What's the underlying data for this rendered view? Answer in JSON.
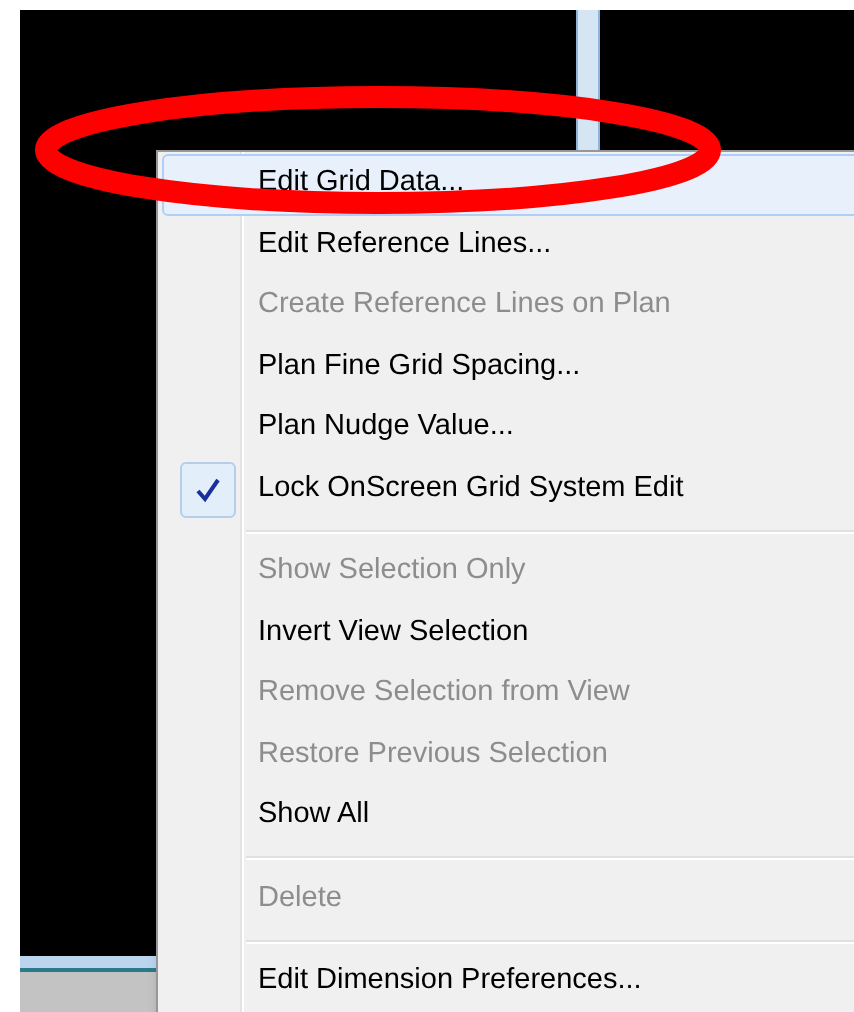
{
  "context_menu": {
    "items": [
      {
        "kind": "item",
        "label": "Edit Grid Data...",
        "selected": true,
        "disabled": false,
        "checked": false
      },
      {
        "kind": "item",
        "label": "Edit Reference Lines...",
        "selected": false,
        "disabled": false,
        "checked": false
      },
      {
        "kind": "item",
        "label": "Create Reference Lines on Plan",
        "selected": false,
        "disabled": true,
        "checked": false
      },
      {
        "kind": "item",
        "label": "Plan Fine Grid Spacing...",
        "selected": false,
        "disabled": false,
        "checked": false
      },
      {
        "kind": "item",
        "label": "Plan Nudge Value...",
        "selected": false,
        "disabled": false,
        "checked": false
      },
      {
        "kind": "item",
        "label": "Lock OnScreen Grid System Edit",
        "selected": false,
        "disabled": false,
        "checked": true
      },
      {
        "kind": "separator"
      },
      {
        "kind": "item",
        "label": "Show Selection Only",
        "selected": false,
        "disabled": true,
        "checked": false
      },
      {
        "kind": "item",
        "label": "Invert View Selection",
        "selected": false,
        "disabled": false,
        "checked": false
      },
      {
        "kind": "item",
        "label": "Remove Selection from View",
        "selected": false,
        "disabled": true,
        "checked": false
      },
      {
        "kind": "item",
        "label": "Restore Previous Selection",
        "selected": false,
        "disabled": true,
        "checked": false
      },
      {
        "kind": "item",
        "label": "Show All",
        "selected": false,
        "disabled": false,
        "checked": false
      },
      {
        "kind": "separator"
      },
      {
        "kind": "item",
        "label": "Delete",
        "selected": false,
        "disabled": true,
        "checked": false
      },
      {
        "kind": "separator"
      },
      {
        "kind": "item",
        "label": "Edit Dimension Preferences...",
        "selected": false,
        "disabled": false,
        "checked": false
      }
    ]
  }
}
